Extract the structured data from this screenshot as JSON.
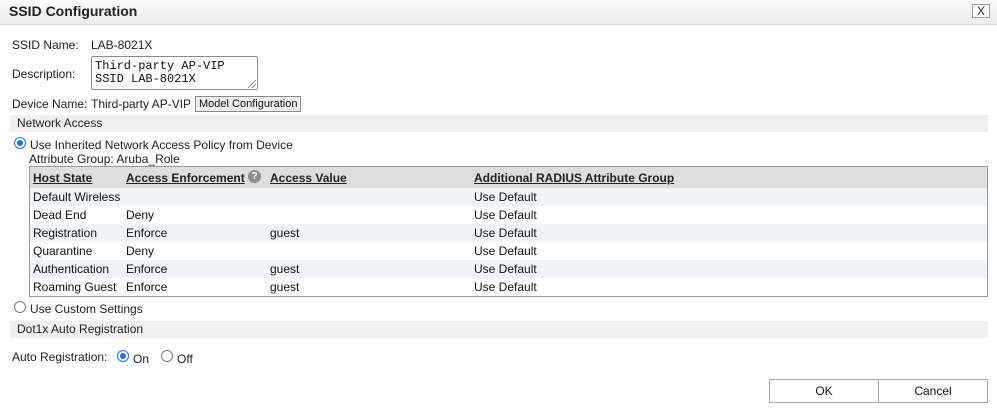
{
  "dialog": {
    "title": "SSID Configuration",
    "close_label": "X"
  },
  "ssid": {
    "name_label": "SSID Name:",
    "name_value": "LAB-8021X"
  },
  "description": {
    "label": "Description:",
    "value": "Third-party AP-VIP\nSSID LAB-8021X"
  },
  "device": {
    "label": "Device Name:",
    "value": "Third-party AP-VIP",
    "model_button": "Model Configuration"
  },
  "network_access": {
    "section_title": "Network Access",
    "inherited_option": "Use Inherited Network Access Policy from Device",
    "inherited_selected": true,
    "attribute_group": "Attribute Group: Aruba_Role",
    "custom_option": "Use Custom Settings",
    "custom_selected": false
  },
  "table": {
    "headers": [
      "Host State",
      "Access Enforcement",
      "Access Value",
      "Additional RADIUS Attribute Group"
    ],
    "rows": [
      [
        "Default Wireless",
        "",
        "",
        "Use Default"
      ],
      [
        "Dead End",
        "Deny",
        "",
        "Use Default"
      ],
      [
        "Registration",
        "Enforce",
        "guest",
        "Use Default"
      ],
      [
        "Quarantine",
        "Deny",
        "",
        "Use Default"
      ],
      [
        "Authentication",
        "Enforce",
        "guest",
        "Use Default"
      ],
      [
        "Roaming Guest",
        "Enforce",
        "guest",
        "Use Default"
      ]
    ]
  },
  "dot1x": {
    "section_title": "Dot1x Auto Registration",
    "label": "Auto Registration:",
    "on_label": "On",
    "off_label": "Off",
    "selected": "On"
  },
  "footer": {
    "ok_label": "OK",
    "cancel_label": "Cancel"
  },
  "colors": {
    "accent": "#1a73e8",
    "header_bg": "#dedede",
    "row_alt": "#eef4fa",
    "section_bg": "#f0f0f0"
  }
}
